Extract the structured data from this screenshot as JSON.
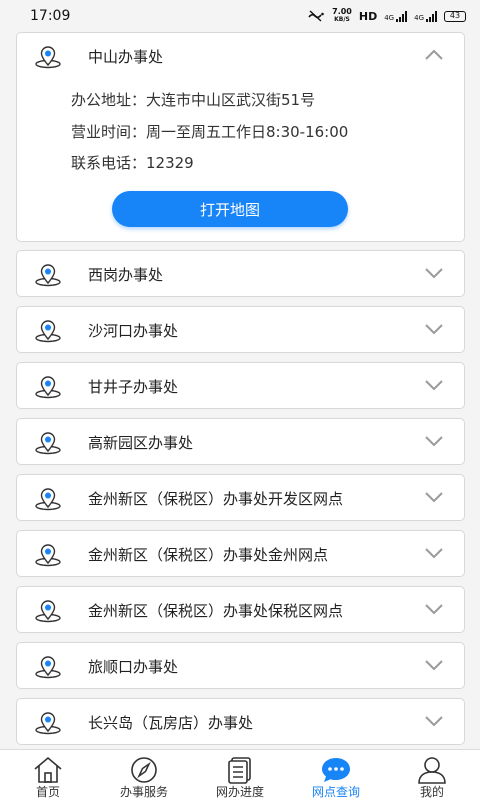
{
  "status_bar": {
    "time": "17:09",
    "net_speed_value": "7.00",
    "net_speed_unit": "KB/S",
    "hd_label": "HD",
    "signal1_label": "4G",
    "signal2_label": "4G",
    "battery": "43"
  },
  "offices": [
    {
      "name": "中山办事处",
      "expanded": true,
      "address": "办公地址：大连市中山区武汉街51号",
      "hours": "营业时间：周一至周五工作日8:30-16:00",
      "phone": "联系电话：12329",
      "map_button": "打开地图"
    },
    {
      "name": "西岗办事处",
      "expanded": false
    },
    {
      "name": "沙河口办事处",
      "expanded": false
    },
    {
      "name": "甘井子办事处",
      "expanded": false
    },
    {
      "name": "高新园区办事处",
      "expanded": false
    },
    {
      "name": "金州新区（保税区）办事处开发区网点",
      "expanded": false
    },
    {
      "name": "金州新区（保税区）办事处金州网点",
      "expanded": false
    },
    {
      "name": "金州新区（保税区）办事处保税区网点",
      "expanded": false
    },
    {
      "name": "旅顺口办事处",
      "expanded": false
    },
    {
      "name": "长兴岛（瓦房店）办事处",
      "expanded": false
    }
  ],
  "tabbar": {
    "active": "网点查询",
    "accent_color": "#1784f8",
    "tabs": [
      {
        "label": "首页",
        "icon": "home-icon"
      },
      {
        "label": "办事服务",
        "icon": "compass-icon"
      },
      {
        "label": "网办进度",
        "icon": "document-icon"
      },
      {
        "label": "网点查询",
        "icon": "chat-bubble-icon"
      },
      {
        "label": "我的",
        "icon": "user-icon"
      }
    ]
  }
}
